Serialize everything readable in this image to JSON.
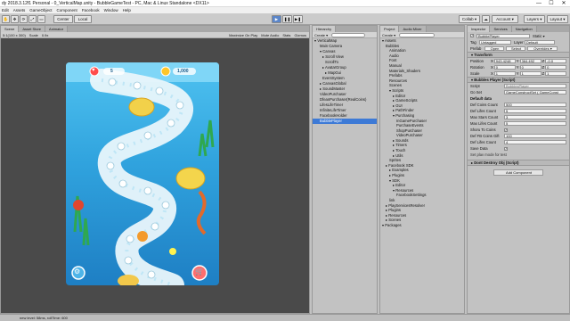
{
  "window": {
    "title": "dy 2018.3.12f1 Personal - 0_VerticalMap.unity - BubbleGameTest - PC, Mac & Linux Standalone <DX11>",
    "minimize": "—",
    "maximize": "☐",
    "close": "✕"
  },
  "menu": [
    "Edit",
    "Assets",
    "GameObject",
    "Component",
    "Facebook",
    "Window",
    "Help"
  ],
  "toolbar": {
    "center_label": "Center",
    "local_label": "Local",
    "play": "▶",
    "pause": "❚❚",
    "step": "▶❚",
    "collab_label": "Collab ▾",
    "account_label": "Account ▾",
    "layers_label": "Layers ▾",
    "layout_label": "Layout ▾"
  },
  "game_view": {
    "tabs": [
      "Scene",
      "Asset Store",
      "Animator"
    ],
    "resolution": "5:1(100 x 300)",
    "scale_label": "Scale",
    "scale_value": "0.9x",
    "maximize_label": "Maximize On Play",
    "mute_label": "Mute Audio",
    "stats_label": "Stats",
    "gizmos_label": "Gizmos",
    "hud_value_1": "5",
    "hud_value_2": "1,000"
  },
  "hierarchy": {
    "tab": "Hierarchy",
    "create": "Create ▾",
    "search_placeholder": "All",
    "items": [
      {
        "label": "▾ VerticalMap",
        "selected": false,
        "indent": 0
      },
      {
        "label": "Main Camera",
        "selected": false,
        "indent": 2
      },
      {
        "label": "▾ Canvas",
        "selected": false,
        "indent": 2
      },
      {
        "label": "▸ Scroll View",
        "selected": false,
        "indent": 3
      },
      {
        "label": "ScrollTo",
        "selected": false,
        "indent": 4
      },
      {
        "label": "▸ AvatarGroup",
        "selected": false,
        "indent": 3
      },
      {
        "label": "▸ MapGui",
        "selected": false,
        "indent": 4
      },
      {
        "label": "EventSystem",
        "selected": false,
        "indent": 3
      },
      {
        "label": "▸ CanvasGlobal",
        "selected": false,
        "indent": 2
      },
      {
        "label": "▸ SoundMaster",
        "selected": false,
        "indent": 2
      },
      {
        "label": "VideoPurchaser",
        "selected": false,
        "indent": 2
      },
      {
        "label": "DfeanPurchaser(RealCoins)",
        "selected": false,
        "indent": 2
      },
      {
        "label": "LifesLifeTimer",
        "selected": false,
        "indent": 2
      },
      {
        "label": "InfiniteLifeTimer",
        "selected": false,
        "indent": 2
      },
      {
        "label": "FacebookHolder",
        "selected": false,
        "indent": 2
      },
      {
        "label": "BubblePlayer",
        "selected": true,
        "indent": 2
      }
    ]
  },
  "project": {
    "tabs": [
      "Project",
      "Audio Mixer"
    ],
    "create": "Create ▾",
    "items": [
      {
        "label": "▾ Assets",
        "indent": 0
      },
      {
        "label": "Bubbles",
        "indent": 1
      },
      {
        "label": "Animation",
        "indent": 2
      },
      {
        "label": "Audio",
        "indent": 2
      },
      {
        "label": "Font",
        "indent": 2
      },
      {
        "label": "Manual",
        "indent": 2
      },
      {
        "label": "Materials_Shaders",
        "indent": 2
      },
      {
        "label": "Prefabs",
        "indent": 2
      },
      {
        "label": "Resources",
        "indent": 2
      },
      {
        "label": "Scenes",
        "indent": 2
      },
      {
        "label": "▾ Scripts",
        "indent": 2
      },
      {
        "label": "▸ Editor",
        "indent": 3
      },
      {
        "label": "▸ GameScripts",
        "indent": 3
      },
      {
        "label": "▸ GUI",
        "indent": 3
      },
      {
        "label": "▸ PathFinder",
        "indent": 3
      },
      {
        "label": "▾ Purchasing",
        "indent": 3
      },
      {
        "label": "InGamePurchaser",
        "indent": 4
      },
      {
        "label": "PurchaseEvents",
        "indent": 4
      },
      {
        "label": "ShopPurchaser",
        "indent": 4
      },
      {
        "label": "VideoPurchaser",
        "indent": 4
      },
      {
        "label": "▸ Sounds",
        "indent": 3
      },
      {
        "label": "▸ Timers",
        "indent": 3
      },
      {
        "label": "▸ Touch",
        "indent": 3
      },
      {
        "label": "▸ Utils",
        "indent": 3
      },
      {
        "label": "Sprites",
        "indent": 2
      },
      {
        "label": "▸ Facebook SDK",
        "indent": 1
      },
      {
        "label": "▸ Examples",
        "indent": 2
      },
      {
        "label": "▸ Plugins",
        "indent": 2
      },
      {
        "label": "▾ SDK",
        "indent": 2
      },
      {
        "label": "▸ Editor",
        "indent": 3
      },
      {
        "label": "▾ Resources",
        "indent": 3
      },
      {
        "label": "FacebookSettings",
        "indent": 4
      },
      {
        "label": "link",
        "indent": 2
      },
      {
        "label": "▸ PlayServicesResolver",
        "indent": 1
      },
      {
        "label": "▸ Plugins",
        "indent": 1
      },
      {
        "label": "▸ Resources",
        "indent": 1
      },
      {
        "label": "▸ Scenes",
        "indent": 1
      },
      {
        "label": "▾ Packages",
        "indent": 0
      }
    ]
  },
  "inspector": {
    "tabs": [
      "Inspector",
      "Services",
      "Navigation"
    ],
    "object_name": "BubblePlayer",
    "static_label": "Static ▾",
    "tag_label": "Tag",
    "tag_value": "Untagged",
    "layer_label": "Layer",
    "layer_value": "Default",
    "prefab_label": "Prefab",
    "prefab_buttons": [
      "Open",
      "Select",
      "Overrides ▾"
    ],
    "transform_title": "Transform",
    "transform_rows": [
      {
        "label": "Position",
        "x": "943.4248",
        "y": "364.492",
        "z": "-0.0"
      },
      {
        "label": "Rotation",
        "x": "0",
        "y": "0",
        "z": "0"
      },
      {
        "label": "Scale",
        "x": "1",
        "y": "1",
        "z": "1"
      }
    ],
    "script_title": "Bubbles Player (Script)",
    "script_label": "Script",
    "script_value": "BubblesPlayer",
    "go_set_label": "Go Set",
    "go_set_value": "GameConstructSet ( GameConst",
    "default_data_header": "Default data",
    "fields": [
      {
        "label": "Def Coins Count",
        "value": "500"
      },
      {
        "label": "Def Lifes Count",
        "value": "5"
      },
      {
        "label": "Max Stars Count",
        "value": "3"
      },
      {
        "label": "Max Lifes Count",
        "value": "5"
      },
      {
        "label": "Shoru To Coins",
        "value": "✓"
      },
      {
        "label": "Def FB Coins Gift",
        "value": "100"
      },
      {
        "label": "Def Lifes Count",
        "value": "4"
      },
      {
        "label": "Save Data",
        "value": "✓"
      }
    ],
    "note": "Set plav mode for test",
    "dont_destroy_title": "Dont Destroy Obj (Script)",
    "add_component": "Add Component"
  },
  "status": {
    "text": "new level: 58ms, rollTime: 600"
  }
}
